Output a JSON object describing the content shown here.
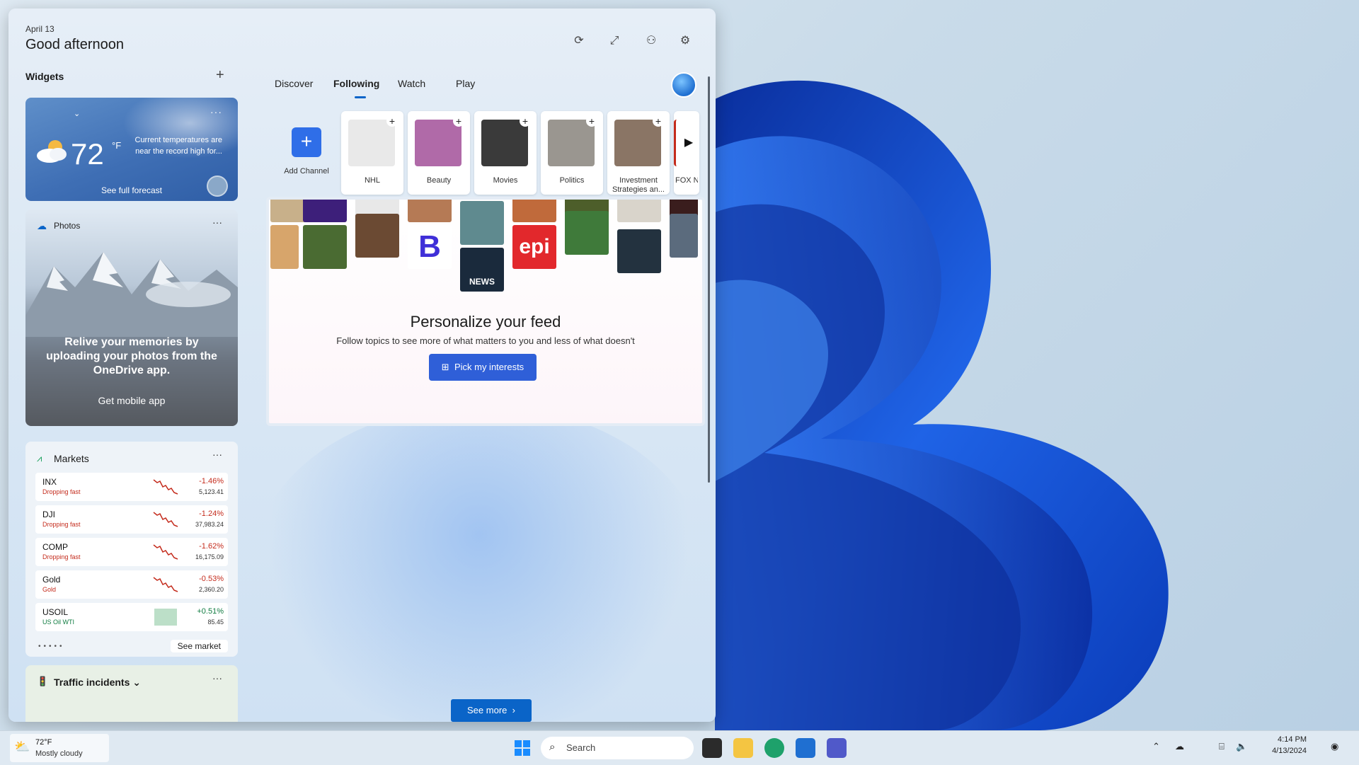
{
  "header": {
    "date": "April 13",
    "greeting": "Good afternoon"
  },
  "widgets": {
    "title": "Widgets",
    "weather": {
      "temp": "72",
      "unit": "°F",
      "note": "Current temperatures are near the record high for...",
      "forecast_link": "See full forecast"
    },
    "photos": {
      "title": "Photos",
      "message": "Relive your memories by uploading your photos from the OneDrive app.",
      "button": "Get mobile app"
    },
    "markets": {
      "title": "Markets",
      "rows": [
        {
          "symbol": "INX",
          "sub": "Dropping fast",
          "pct": "-1.46%",
          "value": "5,123.41",
          "trend": "down"
        },
        {
          "symbol": "DJI",
          "sub": "Dropping fast",
          "pct": "-1.24%",
          "value": "37,983.24",
          "trend": "down"
        },
        {
          "symbol": "COMP",
          "sub": "Dropping fast",
          "pct": "-1.62%",
          "value": "16,175.09",
          "trend": "down"
        },
        {
          "symbol": "Gold",
          "sub": "Gold",
          "pct": "-0.53%",
          "value": "2,360.20",
          "trend": "down"
        },
        {
          "symbol": "USOIL",
          "sub": "US Oil WTI",
          "pct": "+0.51%",
          "value": "85.45",
          "trend": "up"
        }
      ],
      "see_market": "See market"
    },
    "traffic": {
      "title": "Traffic incidents"
    }
  },
  "feed": {
    "tabs": [
      "Discover",
      "Following",
      "Watch",
      "Play"
    ],
    "active_tab": "Following",
    "add_channel": "Add Channel",
    "channels": [
      {
        "label": "NHL",
        "color": "#e9e9e9"
      },
      {
        "label": "Beauty",
        "color": "#b06aa8"
      },
      {
        "label": "Movies",
        "color": "#3a3a3a"
      },
      {
        "label": "Politics",
        "color": "#9a9690"
      },
      {
        "label": "Investment Strategies an...",
        "color": "#8a7565"
      },
      {
        "label": "FOX N",
        "color": "#ffffff"
      }
    ],
    "personalize_title": "Personalize your feed",
    "personalize_sub": "Follow topics to see more of what matters to you and less of what doesn't",
    "pick_button": "Pick my interests",
    "see_more": "See more"
  },
  "taskbar": {
    "weather_temp": "72°F",
    "weather_cond": "Mostly cloudy",
    "search_placeholder": "Search",
    "time": "4:14 PM",
    "date": "4/13/2024"
  },
  "colors": {
    "accent": "#0a64c8",
    "down": "#c42b1c",
    "up": "#107c41"
  }
}
